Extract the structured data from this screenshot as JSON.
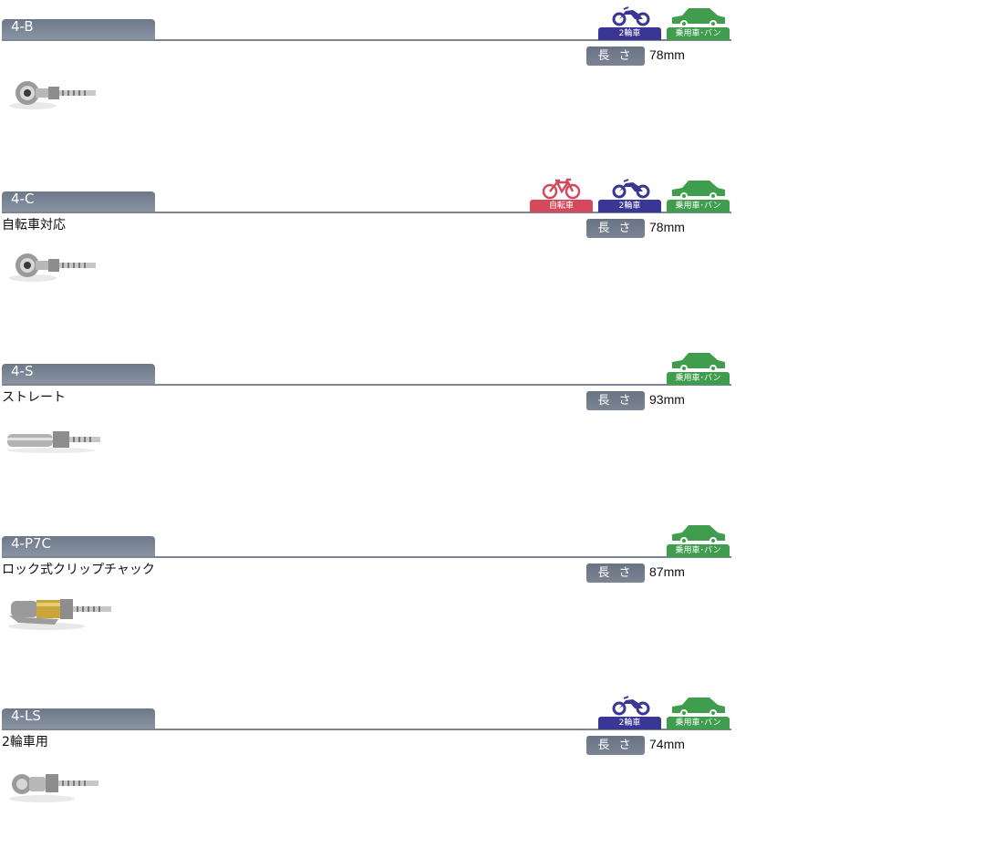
{
  "badge_labels": {
    "bicycle": "自転車",
    "motorcycle": "2輪車",
    "car": "乗用車･バン"
  },
  "colors": {
    "bicycle": "#d44a5d",
    "motorcycle": "#3a3693",
    "car": "#3f9d4d",
    "header_tab": "#7b8494"
  },
  "icons": {
    "bicycle": "bicycle-icon",
    "motorcycle": "motorcycle-icon",
    "car": "car-icon"
  },
  "length_label": "長 さ",
  "products": [
    {
      "code": "4-B",
      "description": "",
      "length": "78mm",
      "vehicles": [
        "motorcycle",
        "car"
      ]
    },
    {
      "code": "4-C",
      "description": "自転車対応",
      "length": "78mm",
      "vehicles": [
        "bicycle",
        "motorcycle",
        "car"
      ]
    },
    {
      "code": "4-S",
      "description": "ストレート",
      "length": "93mm",
      "vehicles": [
        "car"
      ]
    },
    {
      "code": "4-P7C",
      "description": "ロック式クリップチャック",
      "length": "87mm",
      "vehicles": [
        "car"
      ]
    },
    {
      "code": "4-LS",
      "description": "2輪車用",
      "length": "74mm",
      "vehicles": [
        "motorcycle",
        "car"
      ]
    }
  ]
}
